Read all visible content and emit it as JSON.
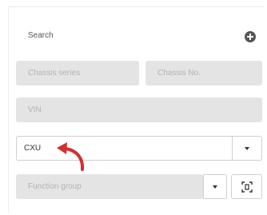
{
  "header": {
    "title": "Search",
    "add_icon": "plus-circle-icon"
  },
  "fields": {
    "chassis_series": {
      "placeholder": "Chassis series"
    },
    "chassis_no": {
      "placeholder": "Chassis No."
    },
    "vin": {
      "placeholder": "VIN"
    },
    "selected_value": {
      "value": "CXU"
    },
    "function_group": {
      "placeholder": "Function group"
    }
  },
  "icons": {
    "dropdown": "caret-down-icon",
    "scan": "scan-icon",
    "annotation": "red-curved-arrow-icon"
  },
  "colors": {
    "annotation_red": "#d32f2f",
    "disabled_field": "#e4e4e4",
    "icon_dark": "#555555"
  }
}
